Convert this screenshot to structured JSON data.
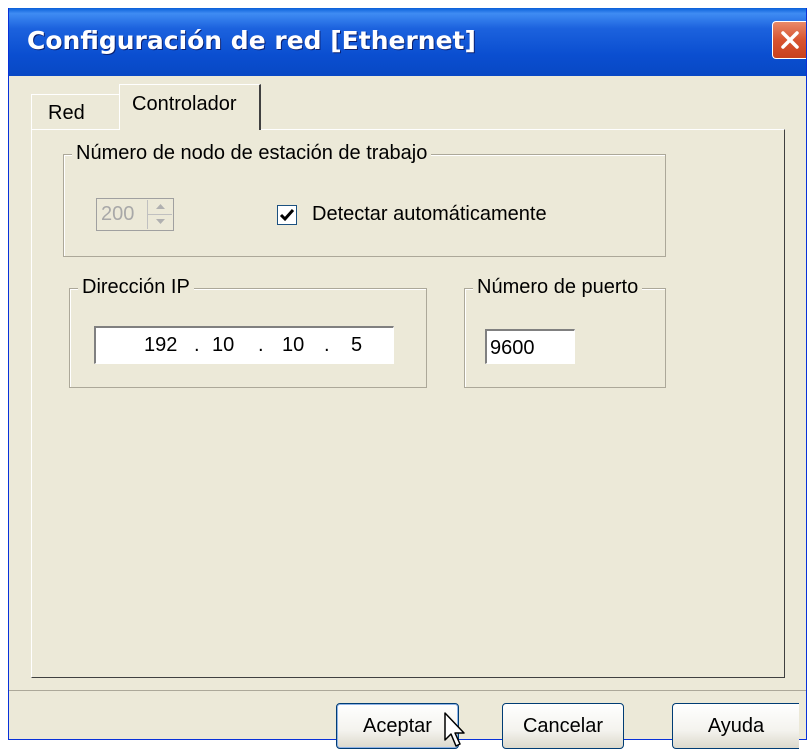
{
  "window": {
    "title": "Configuración de red [Ethernet]"
  },
  "tabs": [
    {
      "label": "Red",
      "active": false
    },
    {
      "label": "Controlador",
      "active": true
    }
  ],
  "node_group": {
    "label": "Número de nodo de estación de trabajo",
    "spinner_value": "200",
    "spinner_enabled": false,
    "checkbox_label": "Detectar automáticamente",
    "checkbox_checked": true
  },
  "ip_group": {
    "label": "Dirección IP",
    "octets": [
      "192",
      "10",
      "10",
      "5"
    ]
  },
  "port_group": {
    "label": "Número de puerto",
    "value": "9600"
  },
  "buttons": {
    "ok": "Aceptar",
    "cancel": "Cancelar",
    "help": "Ayuda"
  },
  "icons": {
    "close": "close-icon",
    "cursor": "mouse-pointer-icon"
  },
  "colors": {
    "titlebar": "#0a4ed0",
    "close": "#d8532f",
    "dialog_bg": "#ece9d8"
  }
}
